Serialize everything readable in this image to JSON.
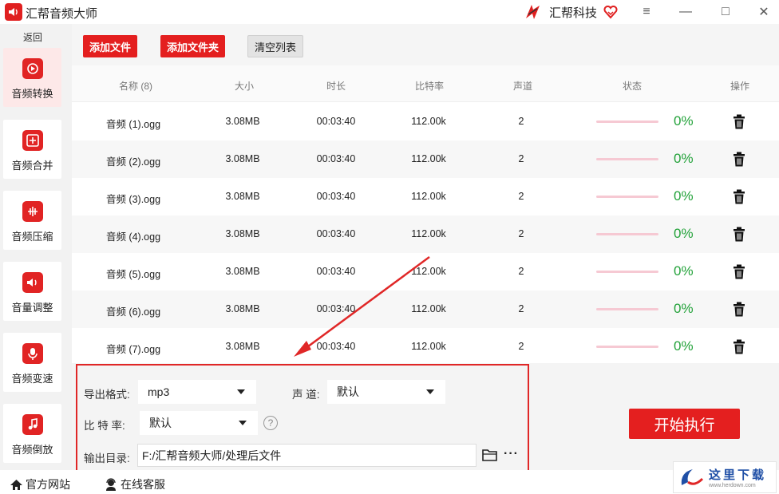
{
  "app": {
    "title": "汇帮音频大师",
    "brand": "汇帮科技"
  },
  "window": {
    "minimize": "—",
    "maximize": "□",
    "close": "✕",
    "menu": "≡"
  },
  "sidebar": {
    "back": "返回",
    "items": [
      {
        "label": "音频转换",
        "icon": "convert-icon"
      },
      {
        "label": "音频合并",
        "icon": "merge-icon"
      },
      {
        "label": "音频压缩",
        "icon": "compress-icon"
      },
      {
        "label": "音量调整",
        "icon": "volume-icon"
      },
      {
        "label": "音频变速",
        "icon": "speed-icon"
      },
      {
        "label": "音频倒放",
        "icon": "reverse-icon"
      }
    ]
  },
  "toolbar": {
    "add_file": "添加文件",
    "add_folder": "添加文件夹",
    "clear_list": "清空列表"
  },
  "table": {
    "headers": [
      "名称 (8)",
      "大小",
      "时长",
      "比特率",
      "声道",
      "状态",
      "操作"
    ],
    "rows": [
      {
        "name": "音频 (1).ogg",
        "size": "3.08MB",
        "duration": "00:03:40",
        "bitrate": "112.00k",
        "channels": "2",
        "status": "0%"
      },
      {
        "name": "音频 (2).ogg",
        "size": "3.08MB",
        "duration": "00:03:40",
        "bitrate": "112.00k",
        "channels": "2",
        "status": "0%"
      },
      {
        "name": "音频 (3).ogg",
        "size": "3.08MB",
        "duration": "00:03:40",
        "bitrate": "112.00k",
        "channels": "2",
        "status": "0%"
      },
      {
        "name": "音频 (4).ogg",
        "size": "3.08MB",
        "duration": "00:03:40",
        "bitrate": "112.00k",
        "channels": "2",
        "status": "0%"
      },
      {
        "name": "音频 (5).ogg",
        "size": "3.08MB",
        "duration": "00:03:40",
        "bitrate": "112.00k",
        "channels": "2",
        "status": "0%"
      },
      {
        "name": "音频 (6).ogg",
        "size": "3.08MB",
        "duration": "00:03:40",
        "bitrate": "112.00k",
        "channels": "2",
        "status": "0%"
      },
      {
        "name": "音频 (7).ogg",
        "size": "3.08MB",
        "duration": "00:03:40",
        "bitrate": "112.00k",
        "channels": "2",
        "status": "0%"
      }
    ]
  },
  "settings": {
    "format_label": "导出格式:",
    "format_value": "mp3",
    "channel_label": "声 道:",
    "channel_value": "默认",
    "bitrate_label": "比 特 率:",
    "bitrate_value": "默认",
    "help": "?",
    "output_label": "输出目录:",
    "output_value": "F:/汇帮音频大师/处理后文件",
    "more": "···"
  },
  "start_button": "开始执行",
  "footer": {
    "website": "官方网站",
    "support": "在线客服"
  },
  "watermark": {
    "text": "这里下载",
    "url": "www.herdown.com"
  },
  "colors": {
    "accent": "#e41f1f",
    "progress": "#f6c9d3",
    "percent": "#23a23a"
  }
}
